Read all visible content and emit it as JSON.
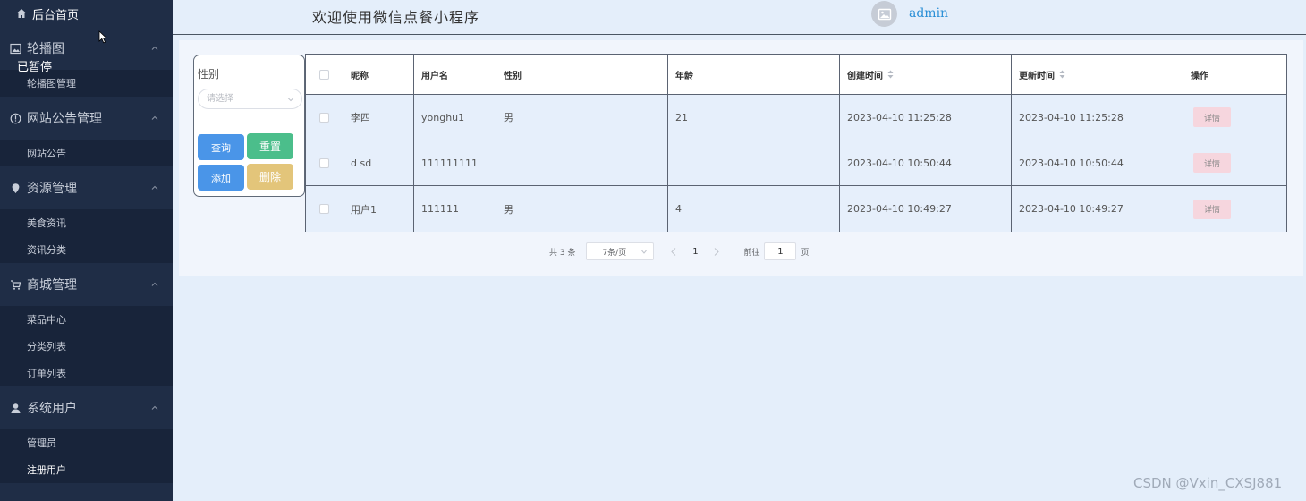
{
  "sidebar": {
    "home_label": "后台首页",
    "overlay_status": "已暂停",
    "groups": [
      {
        "title": "轮播图",
        "items": [
          "轮播图管理"
        ]
      },
      {
        "title": "网站公告管理",
        "items": [
          "网站公告"
        ]
      },
      {
        "title": "资源管理",
        "items": [
          "美食资讯",
          "资讯分类"
        ]
      },
      {
        "title": "商城管理",
        "items": [
          "菜品中心",
          "分类列表",
          "订单列表"
        ]
      },
      {
        "title": "系统用户",
        "items": [
          "管理员",
          "注册用户"
        ]
      }
    ]
  },
  "header": {
    "title": "欢迎使用微信点餐小程序",
    "username": "admin"
  },
  "filter": {
    "label": "性别",
    "placeholder": "请选择",
    "query_label": "查询",
    "reset_label": "重置",
    "add_label": "添加",
    "delete_label": "删除"
  },
  "table": {
    "columns": [
      "昵称",
      "用户名",
      "性别",
      "年龄",
      "创建时间",
      "更新时间",
      "操作"
    ],
    "rows": [
      {
        "nickname": "李四",
        "username": "yonghu1",
        "gender": "男",
        "age": "21",
        "created": "2023-04-10 11:25:28",
        "updated": "2023-04-10 11:25:28",
        "action": "详情"
      },
      {
        "nickname": "d sd",
        "username": "111111111",
        "gender": "",
        "age": "",
        "created": "2023-04-10 10:50:44",
        "updated": "2023-04-10 10:50:44",
        "action": "详情"
      },
      {
        "nickname": "用户1",
        "username": "111111",
        "gender": "男",
        "age": "4",
        "created": "2023-04-10 10:49:27",
        "updated": "2023-04-10 10:49:27",
        "action": "详情"
      }
    ]
  },
  "pagination": {
    "total_text": "共 3 条",
    "page_size": "7条/页",
    "current_page": "1",
    "goto_prefix": "前往",
    "goto_value": "1",
    "goto_suffix": "页"
  },
  "watermark": "CSDN @Vxin_CXSJ881",
  "colors": {
    "sidebar_bg": "#1f2d46",
    "primary": "#4a95e8",
    "success": "#4bbe8b",
    "warning": "#e3c57a",
    "detail": "#f6d6de"
  },
  "icons": {
    "home": "home-icon",
    "carousel": "image-icon",
    "notice": "info-circle-icon",
    "resource": "location-pin-icon",
    "shop": "cart-icon",
    "user": "user-icon"
  }
}
